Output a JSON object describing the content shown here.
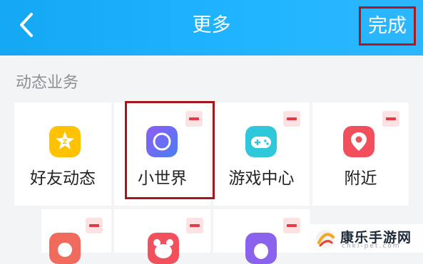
{
  "header": {
    "title": "更多",
    "done_label": "完成"
  },
  "section": {
    "title": "动态业务"
  },
  "tiles": [
    {
      "label": "好友动态",
      "icon": "friends-feed-icon",
      "color": "#ffc200"
    },
    {
      "label": "小世界",
      "icon": "small-world-icon",
      "color": "#6a5cf0"
    },
    {
      "label": "游戏中心",
      "icon": "game-center-icon",
      "color": "#2fc7da"
    },
    {
      "label": "附近",
      "icon": "nearby-icon",
      "color": "#f04f5b"
    }
  ],
  "watermark": {
    "text": "康乐手游网",
    "sub": "chkl-pet.com"
  }
}
